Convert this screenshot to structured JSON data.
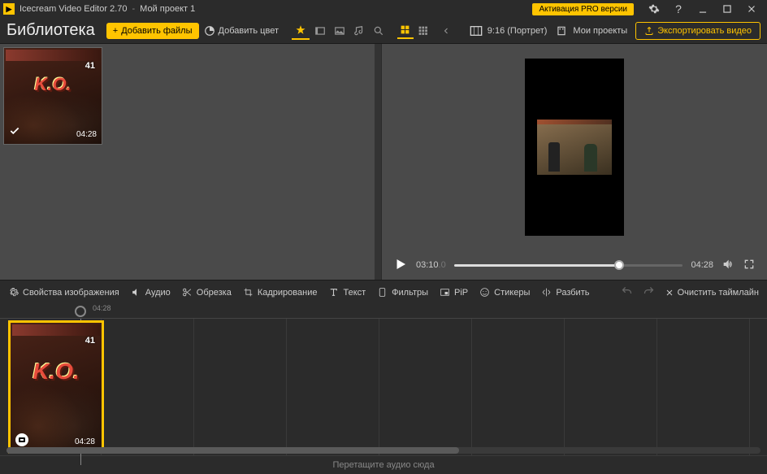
{
  "titlebar": {
    "app_name": "Icecream Video Editor 2.70",
    "separator": "-",
    "project_name": "Мой проект 1",
    "activate_label": "Активация PRO версии"
  },
  "toolbar": {
    "library_title": "Библиотека",
    "add_files": "Добавить файлы",
    "add_color": "Добавить цвет",
    "aspect_ratio": "9:16 (Портрет)",
    "my_projects": "Мои проекты",
    "export_video": "Экспортировать видео"
  },
  "library": {
    "items": [
      {
        "duration": "04:28",
        "game_score": "41",
        "ko": "K.O."
      }
    ]
  },
  "player": {
    "current_time": "03:10",
    "current_ms": ".0",
    "total_time": "04:28"
  },
  "edit_tools": {
    "image_props": "Свойства изображения",
    "audio": "Аудио",
    "trim": "Обрезка",
    "crop": "Кадрирование",
    "text": "Текст",
    "filters": "Фильтры",
    "pip": "PiP",
    "stickers": "Стикеры",
    "split": "Разбить",
    "clear_timeline": "Очистить таймлайн"
  },
  "timeline": {
    "tick_label": "04:28",
    "clip_duration": "04:28",
    "audio_drop_hint": "Перетащите аудио сюда"
  }
}
